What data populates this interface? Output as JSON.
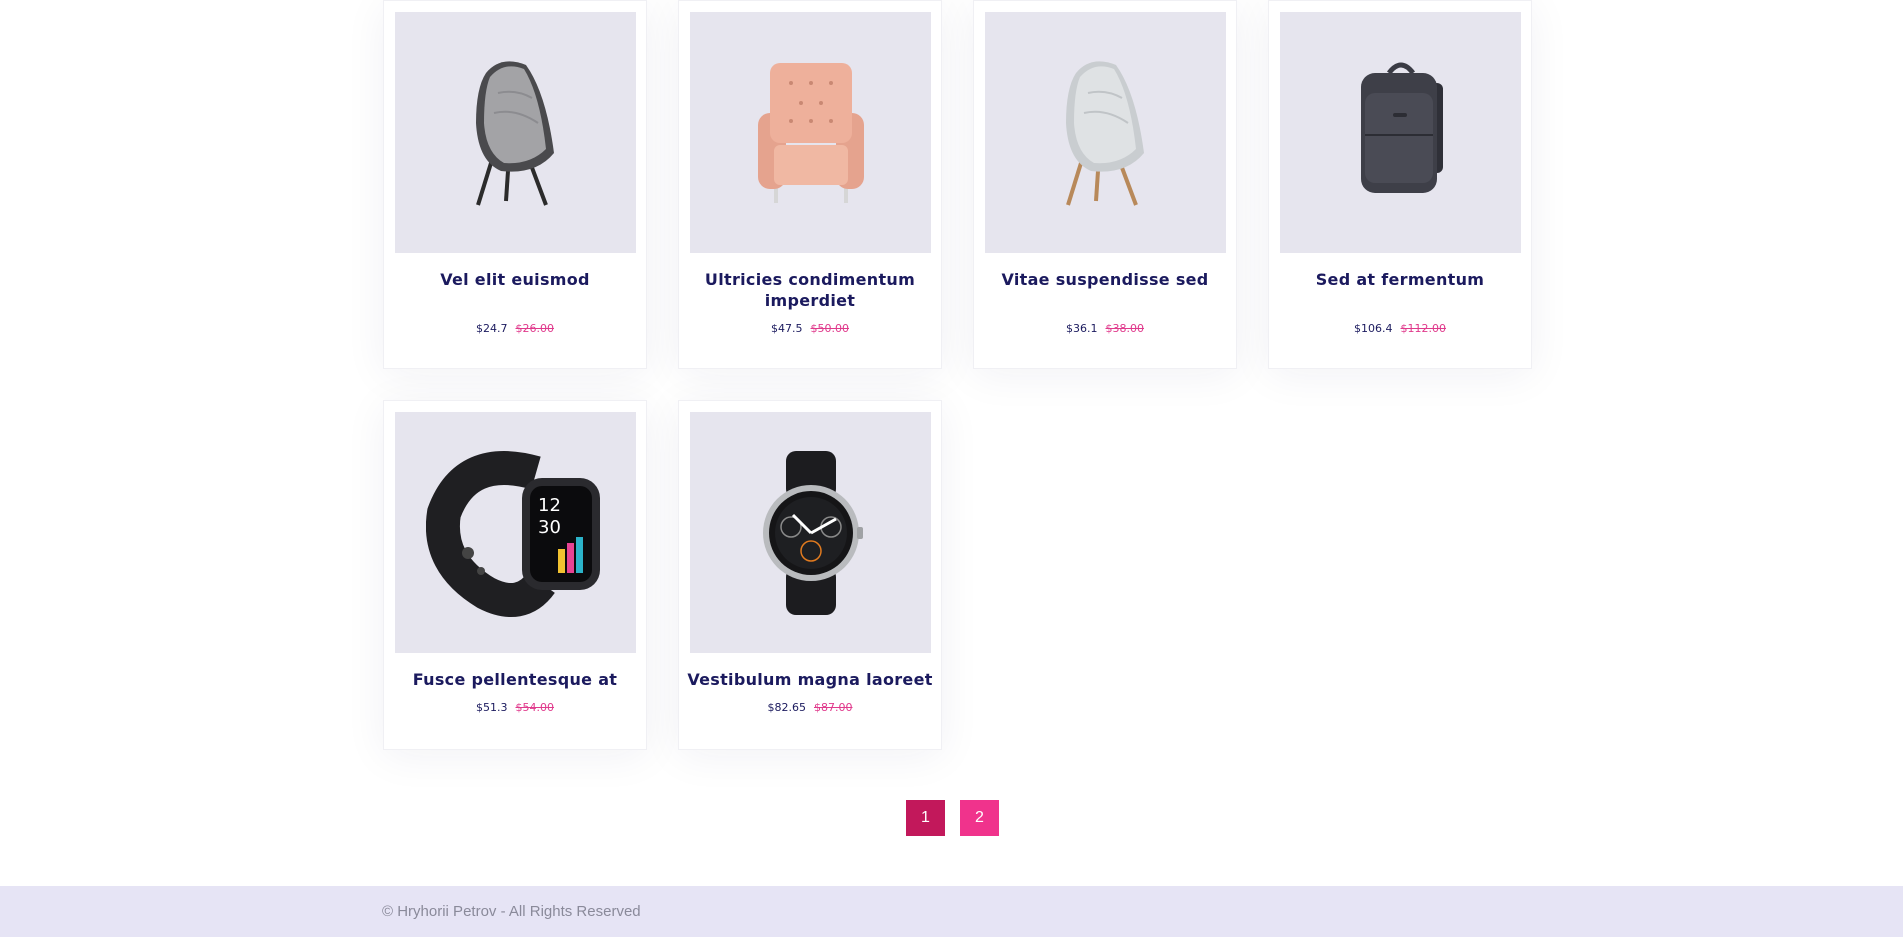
{
  "products": [
    {
      "name": "Vel elit euismod",
      "price": "$24.7",
      "old_price": "$26.00",
      "image": "gray-lounge-chair-icon"
    },
    {
      "name": "Ultricies condimentum imperdiet",
      "price": "$47.5",
      "old_price": "$50.00",
      "image": "pink-armchair-icon"
    },
    {
      "name": "Vitae suspendisse sed",
      "price": "$36.1",
      "old_price": "$38.00",
      "image": "white-lounge-chair-icon"
    },
    {
      "name": "Sed at fermentum",
      "price": "$106.4",
      "old_price": "$112.00",
      "image": "backpack-icon"
    },
    {
      "name": "Fusce pellentesque at",
      "price": "$51.3",
      "old_price": "$54.00",
      "image": "smartwatch-icon"
    },
    {
      "name": "Vestibulum magna laoreet",
      "price": "$82.65",
      "old_price": "$87.00",
      "image": "round-watch-icon"
    }
  ],
  "watch": {
    "hour": "12",
    "minute": "30"
  },
  "pagination": {
    "pages": [
      "1",
      "2"
    ],
    "active": "1",
    "active_color": "#c2185b",
    "inactive_color": "#f0338c"
  },
  "footer": {
    "copyright": "© Hryhorii Petrov - All Rights Reserved"
  },
  "colors": {
    "title": "#1b1a5e",
    "old_price": "#e03a8c",
    "thumb_bg": "#e6e5ee",
    "footer_bg": "#e6e4f5"
  }
}
